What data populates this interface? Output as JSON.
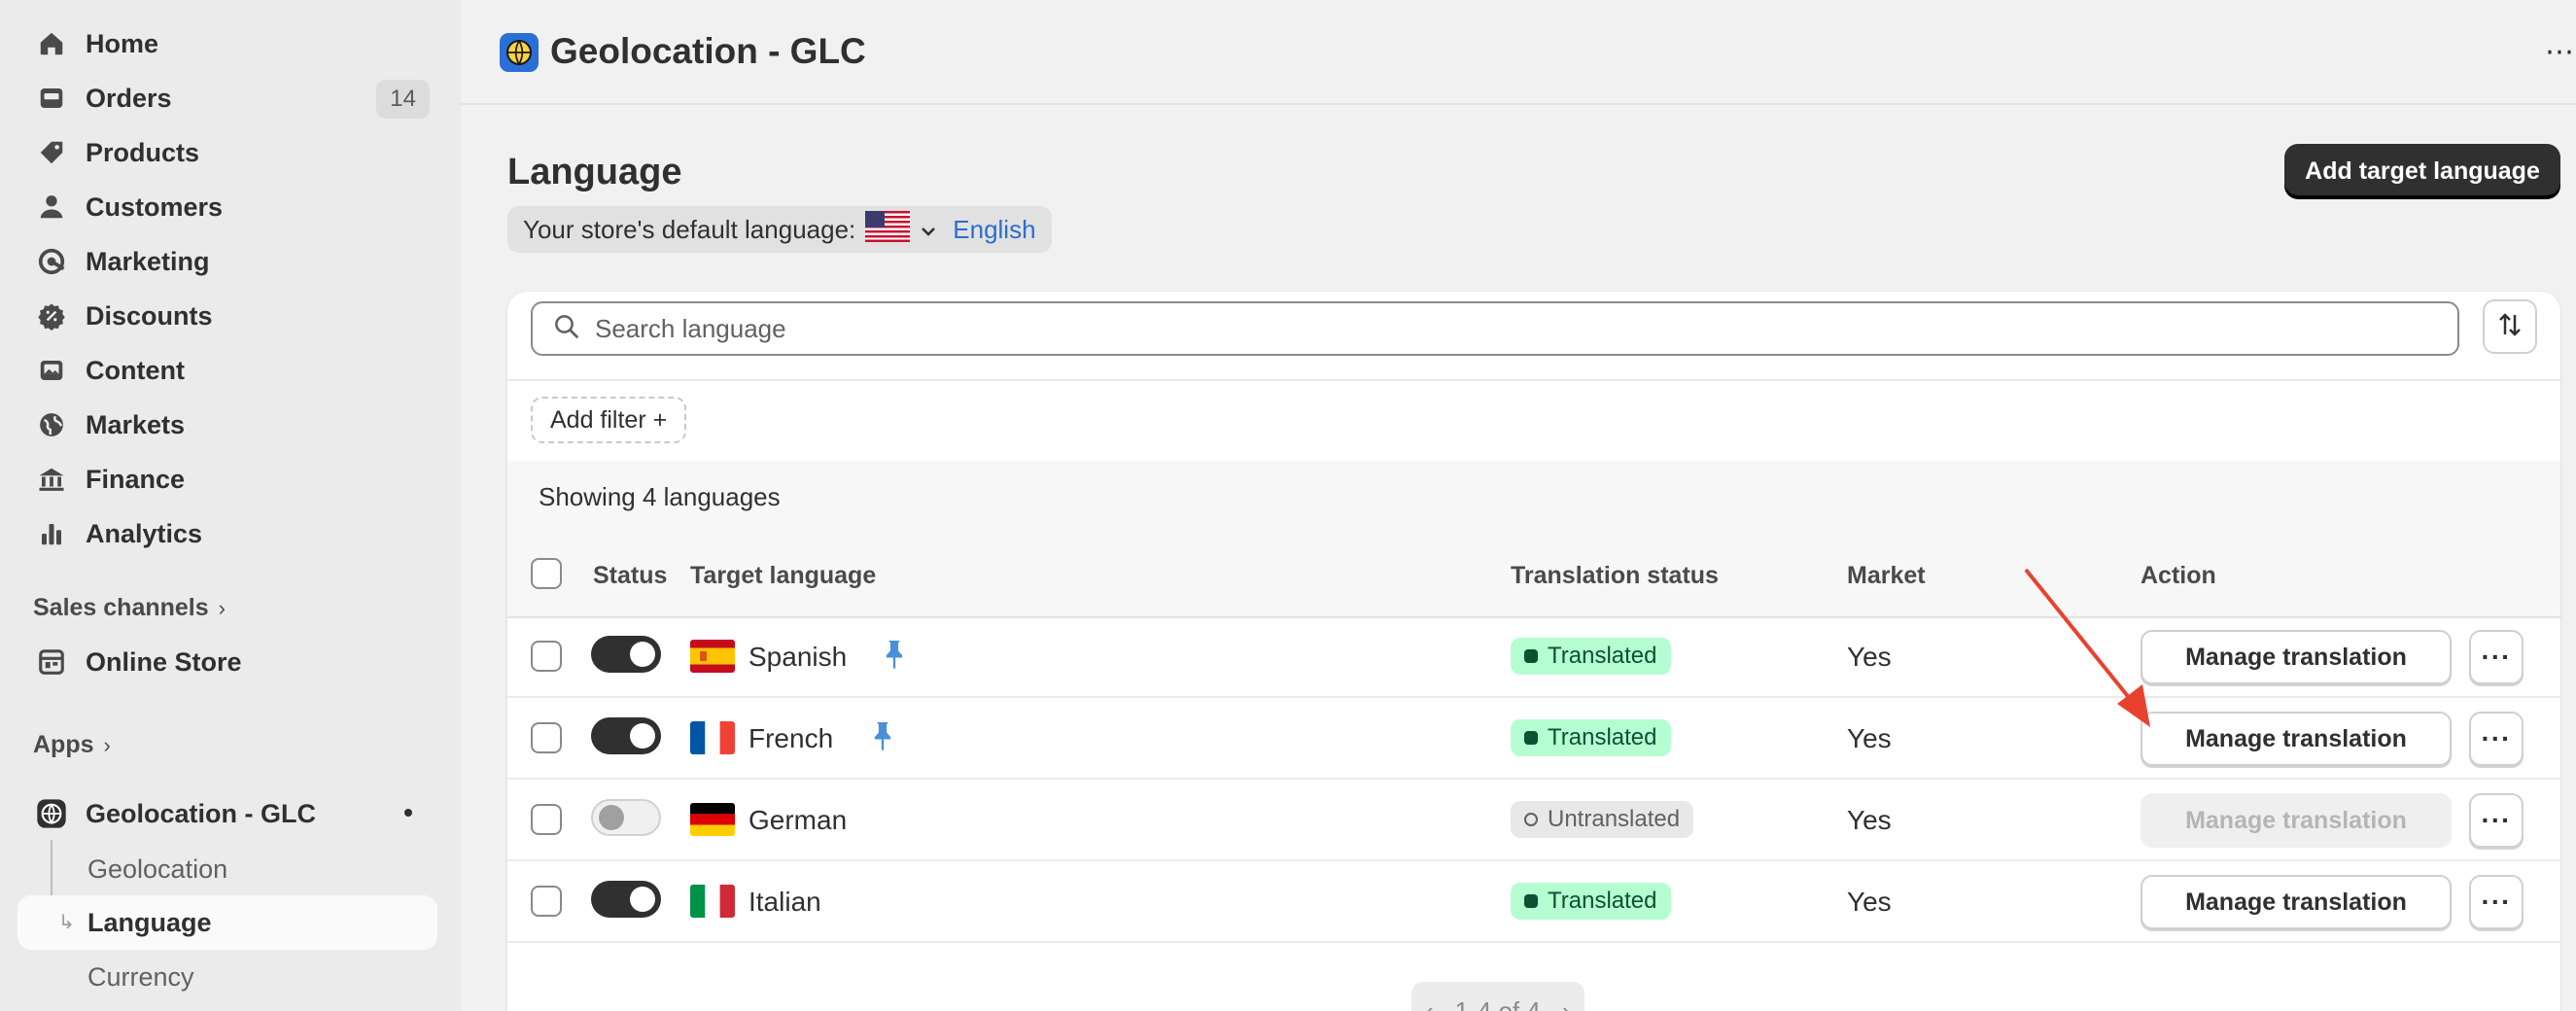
{
  "sidebar": {
    "nav": [
      {
        "label": "Home",
        "icon": "home-icon"
      },
      {
        "label": "Orders",
        "icon": "orders-icon",
        "badge": "14"
      },
      {
        "label": "Products",
        "icon": "tag-icon"
      },
      {
        "label": "Customers",
        "icon": "person-icon"
      },
      {
        "label": "Marketing",
        "icon": "target-icon"
      },
      {
        "label": "Discounts",
        "icon": "discount-icon"
      },
      {
        "label": "Content",
        "icon": "image-icon"
      },
      {
        "label": "Markets",
        "icon": "globe-icon"
      },
      {
        "label": "Finance",
        "icon": "bank-icon"
      },
      {
        "label": "Analytics",
        "icon": "bar-chart-icon"
      }
    ],
    "sales_channels_label": "Sales channels",
    "online_store_label": "Online Store",
    "apps_label": "Apps",
    "app_name": "Geolocation - GLC",
    "app_subitems": [
      "Geolocation",
      "Language",
      "Currency"
    ]
  },
  "topbar": {
    "title": "Geolocation - GLC",
    "more": "⋯"
  },
  "page": {
    "title": "Language",
    "add_button": "Add target language",
    "default_language_label": "Your store's default language:",
    "default_language_value": "English"
  },
  "search": {
    "placeholder": "Search language"
  },
  "filter": {
    "label": "Add filter +"
  },
  "showing": "Showing 4 languages",
  "table": {
    "headers": [
      "Status",
      "Target language",
      "Translation status",
      "Market",
      "Action"
    ],
    "rows": [
      {
        "language": "Spanish",
        "enabled": true,
        "pinned": true,
        "status": "Translated",
        "market": "Yes",
        "action": "Manage translation",
        "action_disabled": false
      },
      {
        "language": "French",
        "enabled": true,
        "pinned": true,
        "status": "Translated",
        "market": "Yes",
        "action": "Manage translation",
        "action_disabled": false
      },
      {
        "language": "German",
        "enabled": false,
        "pinned": false,
        "status": "Untranslated",
        "market": "Yes",
        "action": "Manage translation",
        "action_disabled": true
      },
      {
        "language": "Italian",
        "enabled": true,
        "pinned": false,
        "status": "Translated",
        "market": "Yes",
        "action": "Manage translation",
        "action_disabled": false
      }
    ]
  },
  "pagination": {
    "label": "1-4 of 4"
  },
  "colors": {
    "annotation_arrow": "#e8422f",
    "link": "#2c6ecb",
    "translated_bg": "#b4fed2"
  }
}
